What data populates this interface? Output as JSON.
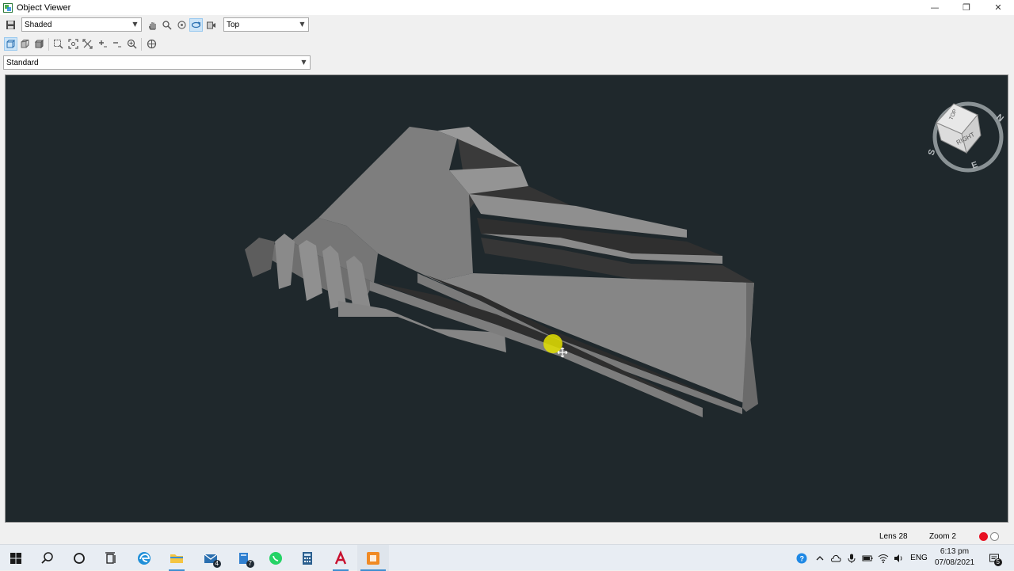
{
  "window": {
    "title": "Object Viewer",
    "minimize_glyph": "—",
    "restore_glyph": "❐",
    "close_glyph": "✕",
    "app_icon": "object-viewer-icon"
  },
  "toolbar": {
    "visual_style": "Shaded",
    "view_preset": "Top",
    "visual_preset": "Standard",
    "active_tool": "orbit"
  },
  "viewcube": {
    "face_top": "TOP",
    "face_right": "RIGHT",
    "compass": {
      "n": "N",
      "s": "S",
      "e": "E"
    }
  },
  "statusbar": {
    "lens": "Lens 28",
    "zoom": "Zoom 2"
  },
  "taskbar": {
    "mail_badge": "4",
    "files_badge": "7",
    "clock_time": "6:13 pm",
    "clock_date": "07/08/2021",
    "language": "ENG",
    "notifications_badge": "5"
  },
  "colors": {
    "viewport_bg": "#1f282c",
    "model_light": "#8c8c8c",
    "model_mid": "#7a7a7a",
    "model_dark": "#3b3b3b",
    "cursor_highlight": "#e3e000",
    "accent": "#3e8ed0"
  }
}
